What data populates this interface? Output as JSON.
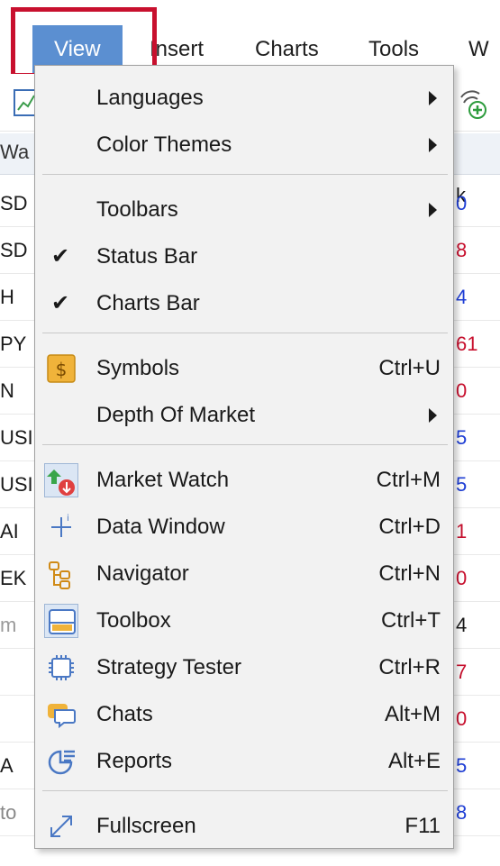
{
  "menubar": {
    "items": [
      "View",
      "Insert",
      "Charts",
      "Tools",
      "W"
    ]
  },
  "background": {
    "watch_header_label": "Wa",
    "watch_header_right": "k",
    "symbol_fragments": [
      "SD",
      "SD",
      "H",
      "PY",
      "N",
      "USI",
      "USI",
      "AI",
      "EK",
      "m",
      "",
      "",
      "A",
      "to"
    ],
    "value_fragments": [
      {
        "text": "0",
        "color": "#1f3fd6"
      },
      {
        "text": "8",
        "color": "#c8102e"
      },
      {
        "text": "4",
        "color": "#1f3fd6"
      },
      {
        "text": "61",
        "color": "#c8102e"
      },
      {
        "text": "0",
        "color": "#c8102e"
      },
      {
        "text": "5",
        "color": "#1f3fd6"
      },
      {
        "text": "5",
        "color": "#1f3fd6"
      },
      {
        "text": "1",
        "color": "#c8102e"
      },
      {
        "text": "0",
        "color": "#c8102e"
      },
      {
        "text": "4",
        "color": "#1a1a1a"
      },
      {
        "text": "7",
        "color": "#c8102e"
      },
      {
        "text": "0",
        "color": "#c8102e"
      },
      {
        "text": "5",
        "color": "#1f3fd6"
      },
      {
        "text": "8",
        "color": "#1f3fd6"
      }
    ]
  },
  "menu": {
    "items": [
      {
        "label": "Languages",
        "shortcut": "",
        "submenu": true,
        "checked": false,
        "icon": ""
      },
      {
        "label": "Color Themes",
        "shortcut": "",
        "submenu": true,
        "checked": false,
        "icon": ""
      },
      {
        "label": "Toolbars",
        "shortcut": "",
        "submenu": true,
        "checked": false,
        "icon": ""
      },
      {
        "label": "Status Bar",
        "shortcut": "",
        "submenu": false,
        "checked": true,
        "icon": ""
      },
      {
        "label": "Charts Bar",
        "shortcut": "",
        "submenu": false,
        "checked": true,
        "icon": ""
      },
      {
        "label": "Symbols",
        "shortcut": "Ctrl+U",
        "submenu": false,
        "checked": false,
        "icon": "dollar-icon"
      },
      {
        "label": "Depth Of Market",
        "shortcut": "",
        "submenu": true,
        "checked": false,
        "icon": ""
      },
      {
        "label": "Market Watch",
        "shortcut": "Ctrl+M",
        "submenu": false,
        "checked": false,
        "icon": "market-watch-icon"
      },
      {
        "label": "Data Window",
        "shortcut": "Ctrl+D",
        "submenu": false,
        "checked": false,
        "icon": "crosshair-icon"
      },
      {
        "label": "Navigator",
        "shortcut": "Ctrl+N",
        "submenu": false,
        "checked": false,
        "icon": "navigator-tree-icon"
      },
      {
        "label": "Toolbox",
        "shortcut": "Ctrl+T",
        "submenu": false,
        "checked": false,
        "icon": "toolbox-icon"
      },
      {
        "label": "Strategy Tester",
        "shortcut": "Ctrl+R",
        "submenu": false,
        "checked": false,
        "icon": "chip-icon"
      },
      {
        "label": "Chats",
        "shortcut": "Alt+M",
        "submenu": false,
        "checked": false,
        "icon": "chat-bubbles-icon"
      },
      {
        "label": "Reports",
        "shortcut": "Alt+E",
        "submenu": false,
        "checked": false,
        "icon": "reports-icon"
      },
      {
        "label": "Fullscreen",
        "shortcut": "F11",
        "submenu": false,
        "checked": false,
        "icon": "fullscreen-icon"
      }
    ]
  },
  "colors": {
    "menubar_active": "#5b8fd1",
    "highlight_box": "#c8102e",
    "menu_background": "#f2f2f2",
    "icon_boxed_background": "#dbe6f4"
  }
}
